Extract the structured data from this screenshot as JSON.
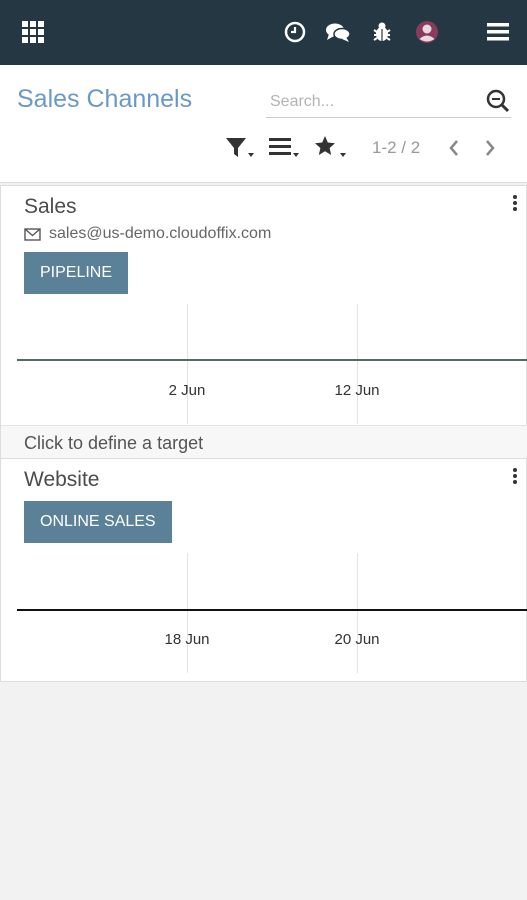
{
  "topbar": {
    "icons": [
      "apps-grid-icon",
      "clock-icon",
      "chat-icon",
      "bug-icon",
      "avatar",
      "hamburger-menu-icon"
    ]
  },
  "control": {
    "title": "Sales Channels",
    "search_placeholder": "Search...",
    "pager": "1-2 / 2"
  },
  "cards": [
    {
      "name": "Sales",
      "email": "sales@us-demo.cloudoffix.com",
      "button": "PIPELINE",
      "ticks": [
        "2 Jun",
        "12 Jun"
      ],
      "target_text": "Click to define a target",
      "line_color": "#4f6d61"
    },
    {
      "name": "Website",
      "button": "ONLINE SALES",
      "ticks": [
        "18 Jun",
        "20 Jun"
      ],
      "line_color": "#111111"
    }
  ],
  "colors": {
    "topbar": "#243742",
    "title": "#6a98c9",
    "button": "#5a8197"
  }
}
